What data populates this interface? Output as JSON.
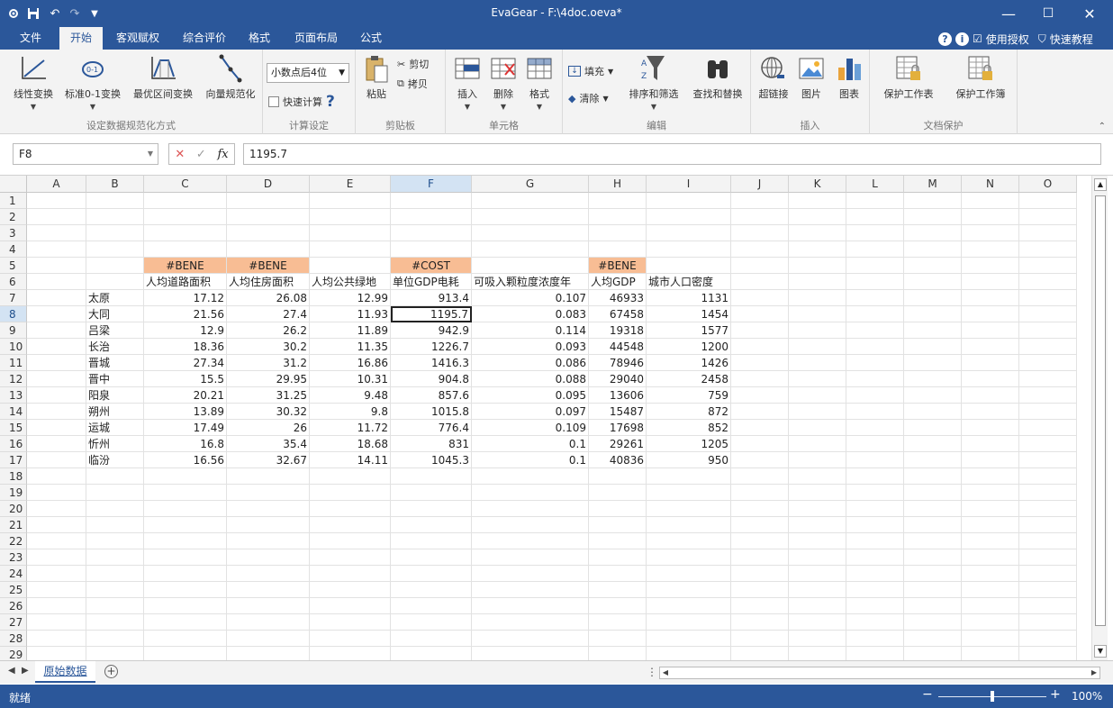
{
  "titlebar": {
    "title": "EvaGear - F:\\4doc.oeva*",
    "app_icon": "gear-icon",
    "save_icon": "save-icon",
    "undo_icon": "undo-icon",
    "redo_icon": "redo-icon",
    "customize_icon": "dropdown-icon",
    "minimize": "—",
    "maximize": "☐",
    "close": "✕"
  },
  "tabs": [
    {
      "label": "文件"
    },
    {
      "label": "开始"
    },
    {
      "label": "客观赋权"
    },
    {
      "label": "综合评价"
    },
    {
      "label": "格式"
    },
    {
      "label": "页面布局"
    },
    {
      "label": "公式"
    }
  ],
  "tabs_right": {
    "help": "?",
    "info": "i",
    "license": "使用授权",
    "tutorial": "快速教程"
  },
  "ribbon": {
    "groups": [
      {
        "label": "设定数据规范化方式"
      },
      {
        "label": "计算设定"
      },
      {
        "label": "剪贴板"
      },
      {
        "label": "单元格"
      },
      {
        "label": "编辑"
      },
      {
        "label": "插入"
      },
      {
        "label": "文档保护"
      }
    ],
    "normalize": {
      "linear": "线性变换",
      "std01": "标准0-1变换",
      "optimal": "最优区间变换",
      "vector": "向量规范化"
    },
    "calc": {
      "decimal_combo": "小数点后4位",
      "quick_calc": "快速计算",
      "help": "?"
    },
    "clipboard": {
      "paste": "粘贴",
      "cut": "剪切",
      "copy": "拷贝"
    },
    "cells": {
      "insert": "插入",
      "delete": "删除",
      "format": "格式"
    },
    "edit": {
      "fill": "填充",
      "clear": "清除",
      "sort_filter": "排序和筛选",
      "find_replace": "查找和替换"
    },
    "insert": {
      "hyperlink": "超链接",
      "picture": "图片",
      "chart": "图表"
    },
    "protect": {
      "sheet": "保护工作表",
      "workbook": "保护工作簿"
    },
    "accent": "#2b579a"
  },
  "formula_bar": {
    "name_box": "F8",
    "cancel": "✕",
    "confirm": "✓",
    "fx": "fx",
    "value": "1195.7"
  },
  "columns": [
    "A",
    "B",
    "C",
    "D",
    "E",
    "F",
    "G",
    "H",
    "I",
    "J",
    "K",
    "L",
    "M",
    "N",
    "O"
  ],
  "rows": [
    "1",
    "2",
    "3",
    "4",
    "5",
    "6",
    "7",
    "8",
    "9",
    "10",
    "11",
    "12",
    "13",
    "14",
    "15",
    "16",
    "17",
    "18",
    "19",
    "20",
    "21",
    "22",
    "23",
    "24",
    "25",
    "26",
    "27",
    "28",
    "29"
  ],
  "sheet": {
    "tags": {
      "C": "#BENE",
      "D": "#BENE",
      "F": "#COST",
      "H": "#BENE"
    },
    "headers": [
      "人均道路面积",
      "人均住房面积",
      "人均公共绿地",
      "单位GDP电耗",
      "可吸入颗粒度浓度年",
      "人均GDP",
      "城市人口密度"
    ],
    "data": [
      [
        "太原",
        "17.12",
        "26.08",
        "12.99",
        "913.4",
        "0.107",
        "46933",
        "1131"
      ],
      [
        "大同",
        "21.56",
        "27.4",
        "11.93",
        "1195.7",
        "0.083",
        "67458",
        "1454"
      ],
      [
        "吕梁",
        "12.9",
        "26.2",
        "11.89",
        "942.9",
        "0.114",
        "19318",
        "1577"
      ],
      [
        "长治",
        "18.36",
        "30.2",
        "11.35",
        "1226.7",
        "0.093",
        "44548",
        "1200"
      ],
      [
        "晋城",
        "27.34",
        "31.2",
        "16.86",
        "1416.3",
        "0.086",
        "78946",
        "1426"
      ],
      [
        "晋中",
        "15.5",
        "29.95",
        "10.31",
        "904.8",
        "0.088",
        "29040",
        "2458"
      ],
      [
        "阳泉",
        "20.21",
        "31.25",
        "9.48",
        "857.6",
        "0.095",
        "13606",
        "759"
      ],
      [
        "朔州",
        "13.89",
        "30.32",
        "9.8",
        "1015.8",
        "0.097",
        "15487",
        "872"
      ],
      [
        "运城",
        "17.49",
        "26",
        "11.72",
        "776.4",
        "0.109",
        "17698",
        "852"
      ],
      [
        "忻州",
        "16.8",
        "35.4",
        "18.68",
        "831",
        "0.1",
        "29261",
        "1205"
      ],
      [
        "临汾",
        "16.56",
        "32.67",
        "14.11",
        "1045.3",
        "0.1",
        "40836",
        "950"
      ]
    ],
    "active_cell": "F8",
    "tag_color": "#f8bd94"
  },
  "sheet_tabs": [
    {
      "label": "原始数据"
    }
  ],
  "status": {
    "ready": "就绪",
    "zoom_minus": "−",
    "zoom_plus": "+",
    "zoom": "100%",
    "zoom_level": 0.5
  }
}
